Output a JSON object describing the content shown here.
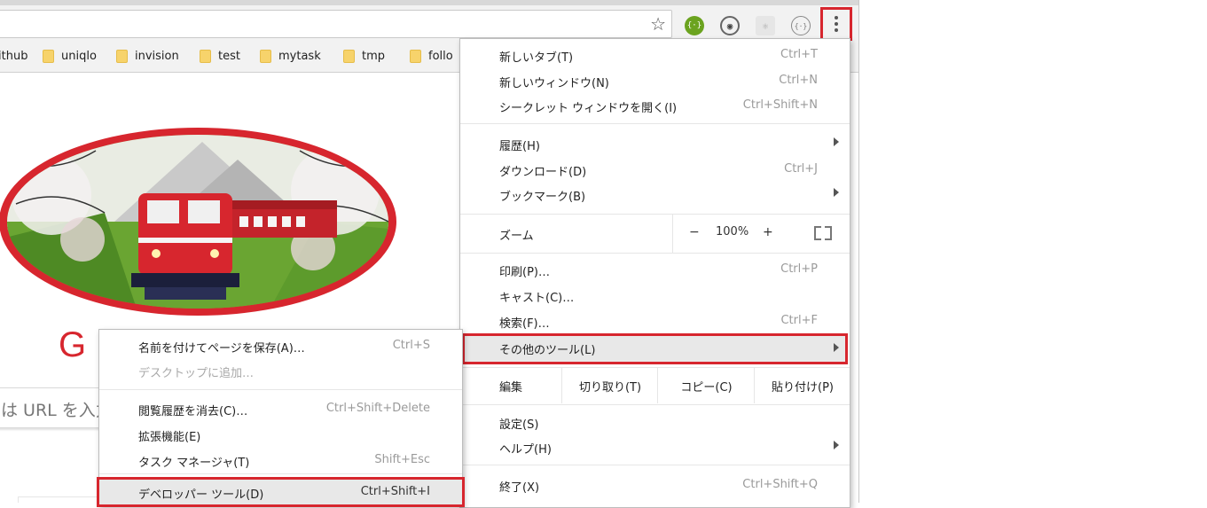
{
  "toolbar": {
    "star_icon": "☆",
    "extensions": [
      {
        "name": "extension-green-icon",
        "glyph": "{·}",
        "color": "#6ba31f"
      },
      {
        "name": "extension-chat-icon",
        "glyph": "◉",
        "color": "#555555"
      },
      {
        "name": "extension-react-icon",
        "glyph": "⚛",
        "color": "#b5b5b5"
      },
      {
        "name": "extension-braces-icon",
        "glyph": "{·}",
        "color": "#777777"
      }
    ]
  },
  "bookmarks": [
    "ithub",
    "uniqlo",
    "invision",
    "test",
    "mytask",
    "tmp",
    "follo"
  ],
  "page": {
    "search_placeholder": "は URL を入力",
    "logo_letter": "G"
  },
  "main_menu": {
    "new_tab": {
      "label": "新しいタブ(T)",
      "shortcut": "Ctrl+T"
    },
    "new_window": {
      "label": "新しいウィンドウ(N)",
      "shortcut": "Ctrl+N"
    },
    "incognito": {
      "label": "シークレット ウィンドウを開く(I)",
      "shortcut": "Ctrl+Shift+N"
    },
    "history": {
      "label": "履歴(H)"
    },
    "downloads": {
      "label": "ダウンロード(D)",
      "shortcut": "Ctrl+J"
    },
    "bookmarks": {
      "label": "ブックマーク(B)"
    },
    "zoom": {
      "label": "ズーム",
      "minus": "−",
      "value": "100%",
      "plus": "+"
    },
    "print": {
      "label": "印刷(P)…",
      "shortcut": "Ctrl+P"
    },
    "cast": {
      "label": "キャスト(C)…"
    },
    "find": {
      "label": "検索(F)…",
      "shortcut": "Ctrl+F"
    },
    "more_tools": {
      "label": "その他のツール(L)"
    },
    "edit": {
      "label": "編集",
      "cut": "切り取り(T)",
      "copy": "コピー(C)",
      "paste": "貼り付け(P)"
    },
    "settings": {
      "label": "設定(S)"
    },
    "help": {
      "label": "ヘルプ(H)"
    },
    "exit": {
      "label": "終了(X)",
      "shortcut": "Ctrl+Shift+Q"
    }
  },
  "sub_menu": {
    "save_page": {
      "label": "名前を付けてページを保存(A)…",
      "shortcut": "Ctrl+S"
    },
    "add_to_desktop": {
      "label": "デスクトップに追加…"
    },
    "clear_history": {
      "label": "閲覧履歴を消去(C)…",
      "shortcut": "Ctrl+Shift+Delete"
    },
    "extensions": {
      "label": "拡張機能(E)"
    },
    "task_manager": {
      "label": "タスク マネージャ(T)",
      "shortcut": "Shift+Esc"
    },
    "dev_tools": {
      "label": "デベロッパー ツール(D)",
      "shortcut": "Ctrl+Shift+I"
    }
  },
  "colors": {
    "highlight": "#d7262e",
    "doodle_red": "#d7262e"
  }
}
